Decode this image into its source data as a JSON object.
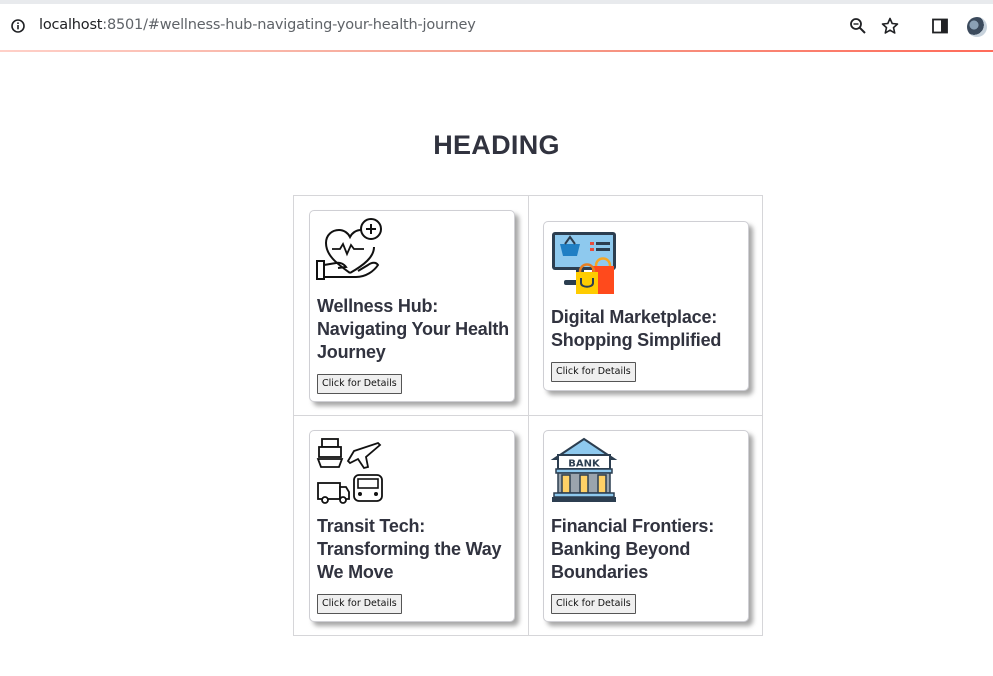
{
  "browser": {
    "url_host": "localhost",
    "url_rest": ":8501/#wellness-hub-navigating-your-health-journey",
    "icons": [
      "info-icon",
      "zoom-icon",
      "bookmark-star-icon",
      "side-panel-icon",
      "profile-avatar"
    ]
  },
  "page": {
    "heading": "HEADING"
  },
  "cards": [
    {
      "title": "Wellness Hub: Navigating Your Health Journey",
      "button_label": "Click for Details",
      "icon": "heart-in-hand-icon"
    },
    {
      "title": "Digital Marketplace: Shopping Simplified",
      "button_label": "Click for Details",
      "icon": "online-shopping-icon"
    },
    {
      "title": "Transit Tech: Transforming the Way We Move",
      "button_label": "Click for Details",
      "icon": "transportation-icon"
    },
    {
      "title": "Financial Frontiers: Banking Beyond Boundaries",
      "button_label": "Click for Details",
      "icon": "bank-icon"
    }
  ],
  "bank_icon_text": "BANK"
}
